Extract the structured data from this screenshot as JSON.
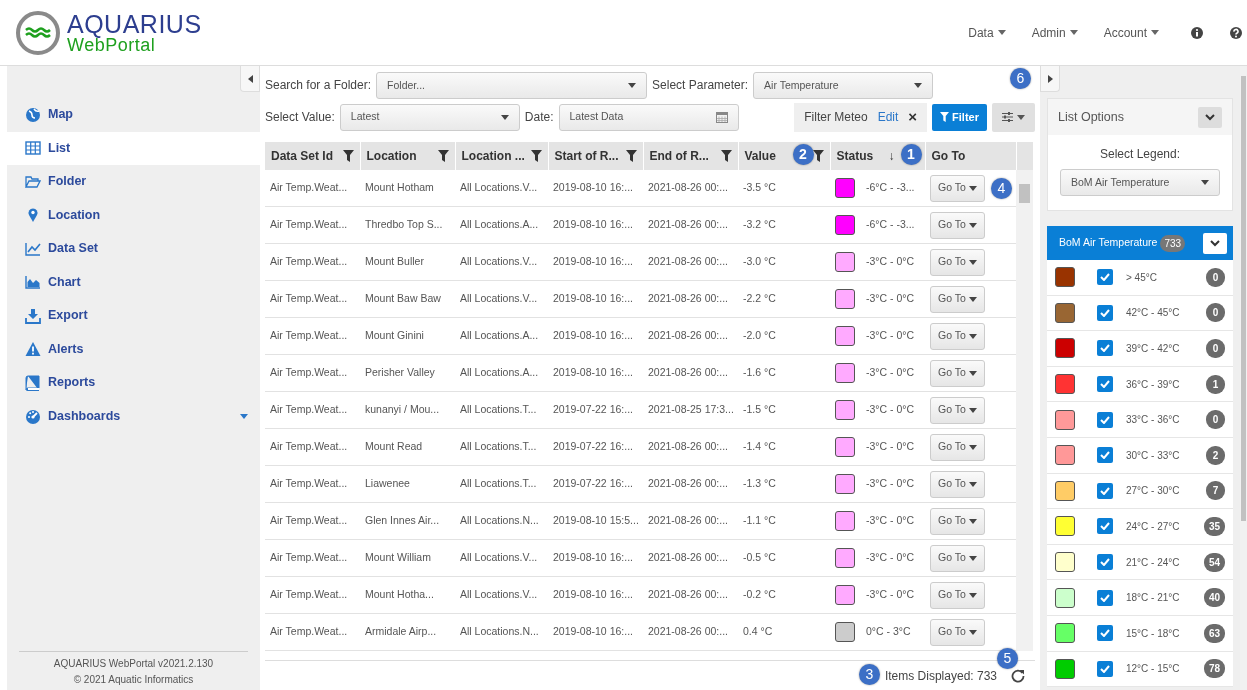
{
  "app": {
    "title": "AQUARIUS",
    "subtitle": "WebPortal"
  },
  "nav": [
    {
      "kind": "dropdown",
      "label": "Data"
    },
    {
      "kind": "dropdown",
      "label": "Admin"
    },
    {
      "kind": "dropdown",
      "label": "Account"
    },
    {
      "kind": "info"
    },
    {
      "kind": "help"
    }
  ],
  "sidebar": {
    "items": [
      {
        "label": "Map",
        "selected": false,
        "submenu": false
      },
      {
        "label": "List",
        "selected": true,
        "submenu": false
      },
      {
        "label": "Folder",
        "selected": false,
        "submenu": false
      },
      {
        "label": "Location",
        "selected": false,
        "submenu": false
      },
      {
        "label": "Data Set",
        "selected": false,
        "submenu": false
      },
      {
        "label": "Chart",
        "selected": false,
        "submenu": false
      },
      {
        "label": "Export",
        "selected": false,
        "submenu": false
      },
      {
        "label": "Alerts",
        "selected": false,
        "submenu": false
      },
      {
        "label": "Reports",
        "selected": false,
        "submenu": false
      },
      {
        "label": "Dashboards",
        "selected": false,
        "submenu": true
      }
    ],
    "footer": [
      "AQUARIUS WebPortal v2021.2.130",
      "© 2021 Aquatic Informatics"
    ]
  },
  "toolbar": {
    "folder": {
      "label": "Search for a Folder:",
      "placeholder": "Folder..."
    },
    "parameter": {
      "label": "Select Parameter:",
      "value": "Air Temperature"
    },
    "value_select": {
      "label": "Select Value:",
      "value": "Latest"
    },
    "date": {
      "label": "Date:",
      "value": "Latest Data"
    },
    "filter_chip": {
      "name": "Filter Meteo",
      "edit": "Edit",
      "remove": "×"
    },
    "filter_button": "Filter",
    "settings_callout": "6"
  },
  "table": {
    "columns": [
      {
        "label": "Data Set Id",
        "filter": true
      },
      {
        "label": "Location",
        "filter": true
      },
      {
        "label": "Location ...",
        "filter": true
      },
      {
        "label": "Start of R...",
        "filter": true
      },
      {
        "label": "End of R...",
        "filter": true
      },
      {
        "label": "Value",
        "filter": true,
        "callout": "2"
      },
      {
        "label": "Status",
        "filter": false,
        "sort": "↓",
        "callout": "1"
      },
      {
        "label": "Go To",
        "filter": false
      }
    ],
    "rows": [
      {
        "cells": [
          "Air Temp.Weat...",
          "Mount Hotham",
          "All Locations.V...",
          "2019-08-10 16:...",
          "2021-08-26 00:...",
          "-3.5 °C"
        ],
        "color": "#ff00ff",
        "status": "-6°C - -3...",
        "goto": "Go To",
        "callout": "4"
      },
      {
        "cells": [
          "Air Temp.Weat...",
          "Thredbo Top S...",
          "All Locations.A...",
          "2019-08-10 16:...",
          "2021-08-26 00:...",
          "-3.2 °C"
        ],
        "color": "#ff00ff",
        "status": "-6°C - -3...",
        "goto": "Go To"
      },
      {
        "cells": [
          "Air Temp.Weat...",
          "Mount Buller",
          "All Locations.V...",
          "2019-08-10 16:...",
          "2021-08-26 00:...",
          "-3.0 °C"
        ],
        "color": "#ffaaff",
        "status": "-3°C - 0°C",
        "goto": "Go To"
      },
      {
        "cells": [
          "Air Temp.Weat...",
          "Mount Baw Baw",
          "All Locations.V...",
          "2019-08-10 16:...",
          "2021-08-26 00:...",
          "-2.2 °C"
        ],
        "color": "#ffaaff",
        "status": "-3°C - 0°C",
        "goto": "Go To"
      },
      {
        "cells": [
          "Air Temp.Weat...",
          "Mount Ginini",
          "All Locations.A...",
          "2019-08-10 16:...",
          "2021-08-26 00:...",
          "-2.0 °C"
        ],
        "color": "#ffaaff",
        "status": "-3°C - 0°C",
        "goto": "Go To"
      },
      {
        "cells": [
          "Air Temp.Weat...",
          "Perisher Valley",
          "All Locations.A...",
          "2019-08-10 16:...",
          "2021-08-26 00:...",
          "-1.6 °C"
        ],
        "color": "#ffaaff",
        "status": "-3°C - 0°C",
        "goto": "Go To"
      },
      {
        "cells": [
          "Air Temp.Weat...",
          "kunanyi / Mou...",
          "All Locations.T...",
          "2019-07-22 16:...",
          "2021-08-25 17:3...",
          "-1.5 °C"
        ],
        "color": "#ffaaff",
        "status": "-3°C - 0°C",
        "goto": "Go To"
      },
      {
        "cells": [
          "Air Temp.Weat...",
          "Mount Read",
          "All Locations.T...",
          "2019-07-22 16:...",
          "2021-08-26 00:...",
          "-1.4 °C"
        ],
        "color": "#ffaaff",
        "status": "-3°C - 0°C",
        "goto": "Go To"
      },
      {
        "cells": [
          "Air Temp.Weat...",
          "Liawenee",
          "All Locations.T...",
          "2019-07-22 16:...",
          "2021-08-26 00:...",
          "-1.3 °C"
        ],
        "color": "#ffaaff",
        "status": "-3°C - 0°C",
        "goto": "Go To"
      },
      {
        "cells": [
          "Air Temp.Weat...",
          "Glen Innes Air...",
          "All Locations.N...",
          "2019-08-10 15:5...",
          "2021-08-26 00:...",
          "-1.1 °C"
        ],
        "color": "#ffaaff",
        "status": "-3°C - 0°C",
        "goto": "Go To"
      },
      {
        "cells": [
          "Air Temp.Weat...",
          "Mount William",
          "All Locations.V...",
          "2019-08-10 16:...",
          "2021-08-26 00:...",
          "-0.5 °C"
        ],
        "color": "#ffaaff",
        "status": "-3°C - 0°C",
        "goto": "Go To"
      },
      {
        "cells": [
          "Air Temp.Weat...",
          "Mount Hotha...",
          "All Locations.V...",
          "2019-08-10 16:...",
          "2021-08-26 00:...",
          "-0.2 °C"
        ],
        "color": "#ffaaff",
        "status": "-3°C - 0°C",
        "goto": "Go To"
      },
      {
        "cells": [
          "Air Temp.Weat...",
          "Armidale Airp...",
          "All Locations.N...",
          "2019-08-10 16:...",
          "2021-08-26 00:...",
          "0.4 °C"
        ],
        "color": "#cccccc",
        "status": "0°C - 3°C",
        "goto": "Go To"
      }
    ]
  },
  "footer": {
    "items_displayed": "Items Displayed: 733",
    "callout": "3",
    "scroll_callout": "5"
  },
  "list_options": {
    "title": "List Options",
    "legend_label": "Select Legend:",
    "legend_value": "BoM Air Temperature"
  },
  "legend": {
    "title": "BoM Air Temperature",
    "count": "733",
    "items": [
      {
        "color": "#993300",
        "checked": true,
        "range": "> 45°C",
        "count": "0"
      },
      {
        "color": "#996633",
        "checked": true,
        "range": "42°C - 45°C",
        "count": "0"
      },
      {
        "color": "#cc0000",
        "checked": true,
        "range": "39°C - 42°C",
        "count": "0"
      },
      {
        "color": "#ff3333",
        "checked": true,
        "range": "36°C - 39°C",
        "count": "1"
      },
      {
        "color": "#ff9999",
        "checked": true,
        "range": "33°C - 36°C",
        "count": "0"
      },
      {
        "color": "#ff9898",
        "checked": true,
        "range": "30°C - 33°C",
        "count": "2"
      },
      {
        "color": "#ffcc66",
        "checked": true,
        "range": "27°C - 30°C",
        "count": "7"
      },
      {
        "color": "#ffff33",
        "checked": true,
        "range": "24°C - 27°C",
        "count": "35"
      },
      {
        "color": "#ffffcc",
        "checked": true,
        "range": "21°C - 24°C",
        "count": "54"
      },
      {
        "color": "#ccffcc",
        "checked": true,
        "range": "18°C - 21°C",
        "count": "40"
      },
      {
        "color": "#66ff66",
        "checked": true,
        "range": "15°C - 18°C",
        "count": "63"
      },
      {
        "color": "#00cc00",
        "checked": true,
        "range": "12°C - 15°C",
        "count": "78"
      }
    ]
  }
}
